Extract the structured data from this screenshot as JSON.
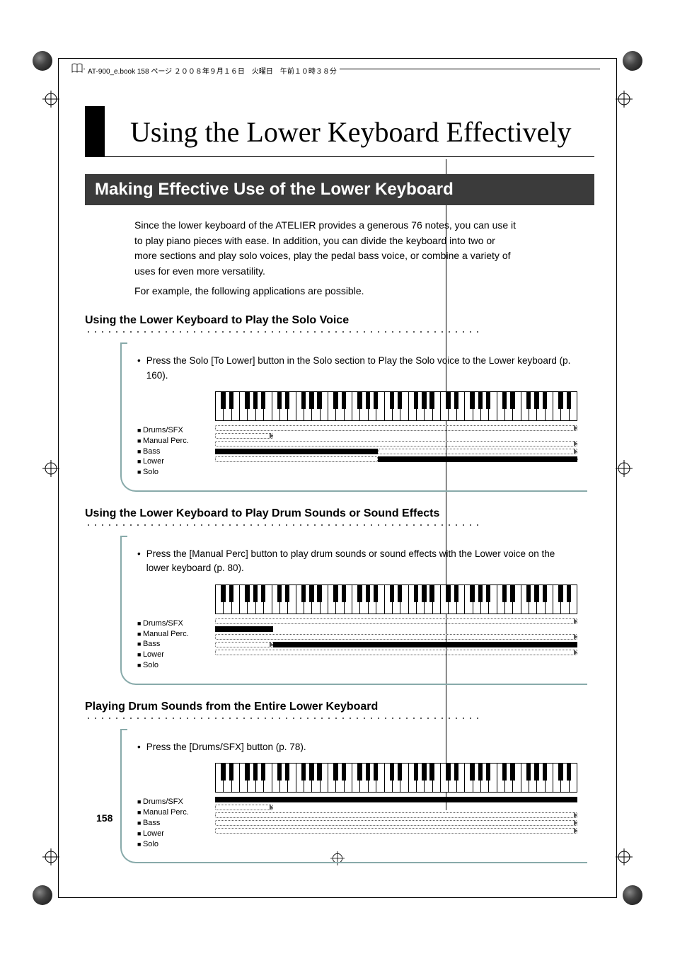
{
  "meta": {
    "header_note": "AT-900_e.book  158 ページ  ２００８年９月１６日　火曜日　午前１０時３８分"
  },
  "chapter_title": "Using the Lower Keyboard Effectively",
  "section_title": "Making Effective Use of the Lower Keyboard",
  "intro_p1": "Since the lower keyboard of the ATELIER provides a generous 76 notes, you can use it to play piano pieces with ease. In addition, you can divide the keyboard into two or more sections and play solo voices, play the pedal bass voice, or combine a variety of uses for even more versatility.",
  "intro_p2": "For example, the following applications are possible.",
  "sub1": {
    "heading": "Using the Lower Keyboard to Play the Solo Voice",
    "bullet": "Press the Solo [To Lower] button in the Solo section to Play the Solo voice to the Lower keyboard (p. 160).",
    "legend": [
      "Drums/SFX",
      "Manual Perc.",
      "Bass",
      "Lower",
      "Solo"
    ]
  },
  "sub2": {
    "heading": "Using the Lower Keyboard to Play Drum Sounds or Sound Effects",
    "bullet": "Press the [Manual Perc] button to play drum sounds or sound effects with the Lower voice on the lower keyboard (p. 80).",
    "legend": [
      "Drums/SFX",
      "Manual Perc.",
      "Bass",
      "Lower",
      "Solo"
    ]
  },
  "sub3": {
    "heading": "Playing Drum Sounds from the Entire Lower Keyboard",
    "bullet": "Press the [Drums/SFX] button (p. 78).",
    "legend": [
      "Drums/SFX",
      "Manual Perc.",
      "Bass",
      "Lower",
      "Solo"
    ]
  },
  "page_number": "158"
}
